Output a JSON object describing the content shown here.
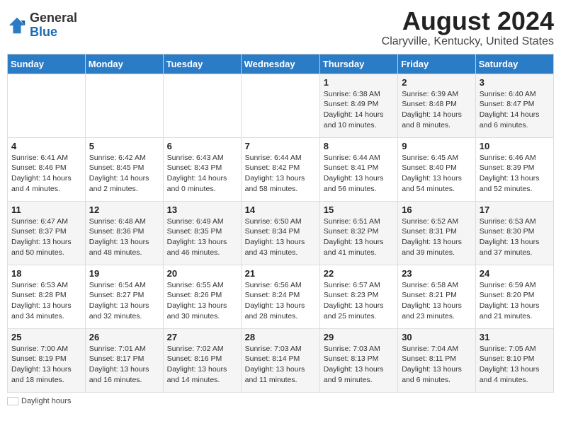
{
  "header": {
    "logo_general": "General",
    "logo_blue": "Blue",
    "month_year": "August 2024",
    "location": "Claryville, Kentucky, United States"
  },
  "days_of_week": [
    "Sunday",
    "Monday",
    "Tuesday",
    "Wednesday",
    "Thursday",
    "Friday",
    "Saturday"
  ],
  "weeks": [
    [
      {
        "day": "",
        "info": ""
      },
      {
        "day": "",
        "info": ""
      },
      {
        "day": "",
        "info": ""
      },
      {
        "day": "",
        "info": ""
      },
      {
        "day": "1",
        "info": "Sunrise: 6:38 AM\nSunset: 8:49 PM\nDaylight: 14 hours and 10 minutes."
      },
      {
        "day": "2",
        "info": "Sunrise: 6:39 AM\nSunset: 8:48 PM\nDaylight: 14 hours and 8 minutes."
      },
      {
        "day": "3",
        "info": "Sunrise: 6:40 AM\nSunset: 8:47 PM\nDaylight: 14 hours and 6 minutes."
      }
    ],
    [
      {
        "day": "4",
        "info": "Sunrise: 6:41 AM\nSunset: 8:46 PM\nDaylight: 14 hours and 4 minutes."
      },
      {
        "day": "5",
        "info": "Sunrise: 6:42 AM\nSunset: 8:45 PM\nDaylight: 14 hours and 2 minutes."
      },
      {
        "day": "6",
        "info": "Sunrise: 6:43 AM\nSunset: 8:43 PM\nDaylight: 14 hours and 0 minutes."
      },
      {
        "day": "7",
        "info": "Sunrise: 6:44 AM\nSunset: 8:42 PM\nDaylight: 13 hours and 58 minutes."
      },
      {
        "day": "8",
        "info": "Sunrise: 6:44 AM\nSunset: 8:41 PM\nDaylight: 13 hours and 56 minutes."
      },
      {
        "day": "9",
        "info": "Sunrise: 6:45 AM\nSunset: 8:40 PM\nDaylight: 13 hours and 54 minutes."
      },
      {
        "day": "10",
        "info": "Sunrise: 6:46 AM\nSunset: 8:39 PM\nDaylight: 13 hours and 52 minutes."
      }
    ],
    [
      {
        "day": "11",
        "info": "Sunrise: 6:47 AM\nSunset: 8:37 PM\nDaylight: 13 hours and 50 minutes."
      },
      {
        "day": "12",
        "info": "Sunrise: 6:48 AM\nSunset: 8:36 PM\nDaylight: 13 hours and 48 minutes."
      },
      {
        "day": "13",
        "info": "Sunrise: 6:49 AM\nSunset: 8:35 PM\nDaylight: 13 hours and 46 minutes."
      },
      {
        "day": "14",
        "info": "Sunrise: 6:50 AM\nSunset: 8:34 PM\nDaylight: 13 hours and 43 minutes."
      },
      {
        "day": "15",
        "info": "Sunrise: 6:51 AM\nSunset: 8:32 PM\nDaylight: 13 hours and 41 minutes."
      },
      {
        "day": "16",
        "info": "Sunrise: 6:52 AM\nSunset: 8:31 PM\nDaylight: 13 hours and 39 minutes."
      },
      {
        "day": "17",
        "info": "Sunrise: 6:53 AM\nSunset: 8:30 PM\nDaylight: 13 hours and 37 minutes."
      }
    ],
    [
      {
        "day": "18",
        "info": "Sunrise: 6:53 AM\nSunset: 8:28 PM\nDaylight: 13 hours and 34 minutes."
      },
      {
        "day": "19",
        "info": "Sunrise: 6:54 AM\nSunset: 8:27 PM\nDaylight: 13 hours and 32 minutes."
      },
      {
        "day": "20",
        "info": "Sunrise: 6:55 AM\nSunset: 8:26 PM\nDaylight: 13 hours and 30 minutes."
      },
      {
        "day": "21",
        "info": "Sunrise: 6:56 AM\nSunset: 8:24 PM\nDaylight: 13 hours and 28 minutes."
      },
      {
        "day": "22",
        "info": "Sunrise: 6:57 AM\nSunset: 8:23 PM\nDaylight: 13 hours and 25 minutes."
      },
      {
        "day": "23",
        "info": "Sunrise: 6:58 AM\nSunset: 8:21 PM\nDaylight: 13 hours and 23 minutes."
      },
      {
        "day": "24",
        "info": "Sunrise: 6:59 AM\nSunset: 8:20 PM\nDaylight: 13 hours and 21 minutes."
      }
    ],
    [
      {
        "day": "25",
        "info": "Sunrise: 7:00 AM\nSunset: 8:19 PM\nDaylight: 13 hours and 18 minutes."
      },
      {
        "day": "26",
        "info": "Sunrise: 7:01 AM\nSunset: 8:17 PM\nDaylight: 13 hours and 16 minutes."
      },
      {
        "day": "27",
        "info": "Sunrise: 7:02 AM\nSunset: 8:16 PM\nDaylight: 13 hours and 14 minutes."
      },
      {
        "day": "28",
        "info": "Sunrise: 7:03 AM\nSunset: 8:14 PM\nDaylight: 13 hours and 11 minutes."
      },
      {
        "day": "29",
        "info": "Sunrise: 7:03 AM\nSunset: 8:13 PM\nDaylight: 13 hours and 9 minutes."
      },
      {
        "day": "30",
        "info": "Sunrise: 7:04 AM\nSunset: 8:11 PM\nDaylight: 13 hours and 6 minutes."
      },
      {
        "day": "31",
        "info": "Sunrise: 7:05 AM\nSunset: 8:10 PM\nDaylight: 13 hours and 4 minutes."
      }
    ]
  ],
  "legend": {
    "daylight_label": "Daylight hours"
  }
}
